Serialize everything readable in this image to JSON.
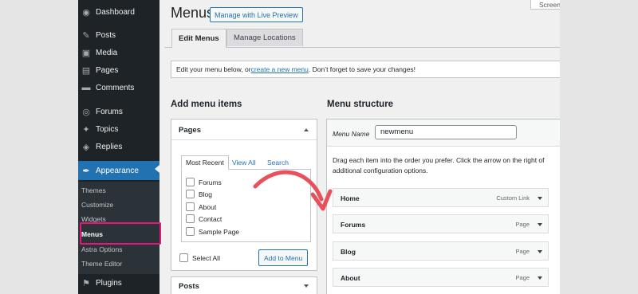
{
  "sidebar": {
    "items": [
      {
        "label": "Dashboard",
        "icon": "dashboard-icon",
        "glyph": "◉"
      },
      {
        "label": "Posts",
        "icon": "pin-icon",
        "glyph": "✎"
      },
      {
        "label": "Media",
        "icon": "media-icon",
        "glyph": "▣"
      },
      {
        "label": "Pages",
        "icon": "page-icon",
        "glyph": "▤"
      },
      {
        "label": "Comments",
        "icon": "comment-icon",
        "glyph": "▬"
      },
      {
        "label": "Forums",
        "icon": "forums-icon",
        "glyph": "◎"
      },
      {
        "label": "Topics",
        "icon": "topics-icon",
        "glyph": "✦"
      },
      {
        "label": "Replies",
        "icon": "replies-icon",
        "glyph": "◈"
      },
      {
        "label": "Appearance",
        "icon": "brush-icon",
        "glyph": "✒"
      },
      {
        "label": "Plugins",
        "icon": "plugin-icon",
        "glyph": "⚑"
      }
    ],
    "submenu": [
      "Themes",
      "Customize",
      "Widgets",
      "Menus",
      "Astra Options",
      "Theme Editor"
    ]
  },
  "header": {
    "title": "Menus",
    "live_preview": "Manage with Live Preview",
    "screen_options": "Screen"
  },
  "tabs": [
    "Edit Menus",
    "Manage Locations"
  ],
  "notice": {
    "before": "Edit your menu below, or ",
    "link": "create a new menu",
    "after": ". Don’t forget to save your changes!"
  },
  "add_items": {
    "heading": "Add menu items",
    "pages_title": "Pages",
    "tabs": [
      "Most Recent",
      "View All",
      "Search"
    ],
    "pages": [
      "Forums",
      "Blog",
      "About",
      "Contact",
      "Sample Page"
    ],
    "select_all": "Select All",
    "add_button": "Add to Menu",
    "posts_title": "Posts"
  },
  "structure": {
    "heading": "Menu structure",
    "name_label": "Menu Name",
    "name_value": "newmenu",
    "instructions_1": "Drag each item into the order you prefer. Click the arrow on the right of",
    "instructions_2": "additional configuration options.",
    "items": [
      {
        "title": "Home",
        "type": "Custom Link"
      },
      {
        "title": "Forums",
        "type": "Page"
      },
      {
        "title": "Blog",
        "type": "Page"
      },
      {
        "title": "About",
        "type": "Page"
      }
    ]
  },
  "colors": {
    "highlight": "#e6177a",
    "annotation_arrow": "#e8505b",
    "wp_blue": "#2271b1",
    "sidebar": "#1d2327"
  }
}
